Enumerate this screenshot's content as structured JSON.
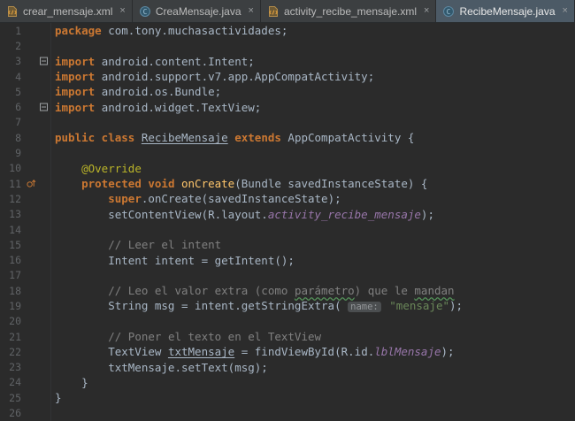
{
  "colors": {
    "bg": "#2b2b2b",
    "tabbar-bg": "#3c3f41",
    "tab-active-bg": "#4c5a66",
    "tab-text": "#bbbbbb",
    "tab-active-text": "#e8e8e8",
    "gutter-text": "#606366",
    "gutter-border": "#313335",
    "def": "#a9b7c6",
    "kw": "#cc7832",
    "ann": "#bbb529",
    "mdecl": "#ffc66b",
    "str": "#6a8759",
    "cmt": "#808080",
    "fld": "#9876aa",
    "typo": "#549159",
    "hint-bg": "#4b4e50",
    "hint-text": "#939699",
    "fold": "#9da0a3",
    "override": "#c57633"
  },
  "tab_bar": {
    "close_glyph": "×",
    "tabs": [
      {
        "label": "crear_mensaje.xml",
        "icon": "xml-file-icon",
        "active": false
      },
      {
        "label": "CreaMensaje.java",
        "icon": "java-class-icon",
        "active": false
      },
      {
        "label": "activity_recibe_mensaje.xml",
        "icon": "xml-file-icon",
        "active": false
      },
      {
        "label": "RecibeMensaje.java",
        "icon": "java-class-icon",
        "active": true
      }
    ]
  },
  "editor": {
    "lines": [
      {
        "n": 1,
        "s": [
          [
            "kw",
            "package "
          ],
          [
            "def",
            "com.tony.muchasactividades;"
          ]
        ]
      },
      {
        "n": 2,
        "s": []
      },
      {
        "n": 3,
        "g": "fold",
        "s": [
          [
            "kw",
            "import "
          ],
          [
            "def",
            "android.content.Intent;"
          ]
        ]
      },
      {
        "n": 4,
        "s": [
          [
            "kw",
            "import "
          ],
          [
            "def",
            "android.support.v7.app.AppCompatActivity;"
          ]
        ]
      },
      {
        "n": 5,
        "s": [
          [
            "kw",
            "import "
          ],
          [
            "def",
            "android.os.Bundle;"
          ]
        ]
      },
      {
        "n": 6,
        "g": "fold",
        "s": [
          [
            "kw",
            "import "
          ],
          [
            "def",
            "android.widget.TextView;"
          ]
        ]
      },
      {
        "n": 7,
        "s": []
      },
      {
        "n": 8,
        "s": [
          [
            "kw",
            "public class "
          ],
          [
            "cls",
            "RecibeMensaje"
          ],
          [
            "kw",
            " extends "
          ],
          [
            "def",
            "AppCompatActivity {"
          ]
        ]
      },
      {
        "n": 9,
        "s": []
      },
      {
        "n": 10,
        "s": [
          [
            "def",
            "    "
          ],
          [
            "ann",
            "@Override"
          ]
        ]
      },
      {
        "n": 11,
        "g": "override",
        "s": [
          [
            "def",
            "    "
          ],
          [
            "kw",
            "protected void "
          ],
          [
            "mdecl",
            "onCreate"
          ],
          [
            "def",
            "(Bundle savedInstanceState) {"
          ]
        ]
      },
      {
        "n": 12,
        "s": [
          [
            "def",
            "        "
          ],
          [
            "kw",
            "super"
          ],
          [
            "def",
            ".onCreate(savedInstanceState);"
          ]
        ]
      },
      {
        "n": 13,
        "s": [
          [
            "def",
            "        setContentView(R.layout."
          ],
          [
            "fld",
            "activity_recibe_mensaje"
          ],
          [
            "def",
            ");"
          ]
        ]
      },
      {
        "n": 14,
        "s": []
      },
      {
        "n": 15,
        "s": [
          [
            "def",
            "        "
          ],
          [
            "cmt",
            "// Leer el intent"
          ]
        ]
      },
      {
        "n": 16,
        "s": [
          [
            "def",
            "        Intent intent = getIntent();"
          ]
        ]
      },
      {
        "n": 17,
        "s": []
      },
      {
        "n": 18,
        "s": [
          [
            "def",
            "        "
          ],
          [
            "cmt",
            "// Leo el valor extra (como "
          ],
          [
            "typo",
            "parámetro"
          ],
          [
            "cmt",
            ") que le "
          ],
          [
            "typo",
            "mandan"
          ]
        ]
      },
      {
        "n": 19,
        "s": [
          [
            "def",
            "        String msg = intent.getStringExtra( "
          ],
          [
            "hint",
            "name:"
          ],
          [
            "def",
            " "
          ],
          [
            "str",
            "\"mensaje\""
          ],
          [
            "def",
            ");"
          ]
        ]
      },
      {
        "n": 20,
        "s": []
      },
      {
        "n": 21,
        "s": [
          [
            "def",
            "        "
          ],
          [
            "cmt",
            "// Poner el texto en el TextView"
          ]
        ]
      },
      {
        "n": 22,
        "s": [
          [
            "def",
            "        TextView "
          ],
          [
            "var",
            "txtMensaje"
          ],
          [
            "def",
            " = findViewById(R.id."
          ],
          [
            "fld",
            "lblMensaje"
          ],
          [
            "def",
            ");"
          ]
        ]
      },
      {
        "n": 23,
        "s": [
          [
            "def",
            "        txtMensaje.setText(msg);"
          ]
        ]
      },
      {
        "n": 24,
        "s": [
          [
            "def",
            "    }"
          ]
        ]
      },
      {
        "n": 25,
        "s": [
          [
            "def",
            "}"
          ]
        ]
      },
      {
        "n": 26,
        "s": []
      }
    ]
  }
}
